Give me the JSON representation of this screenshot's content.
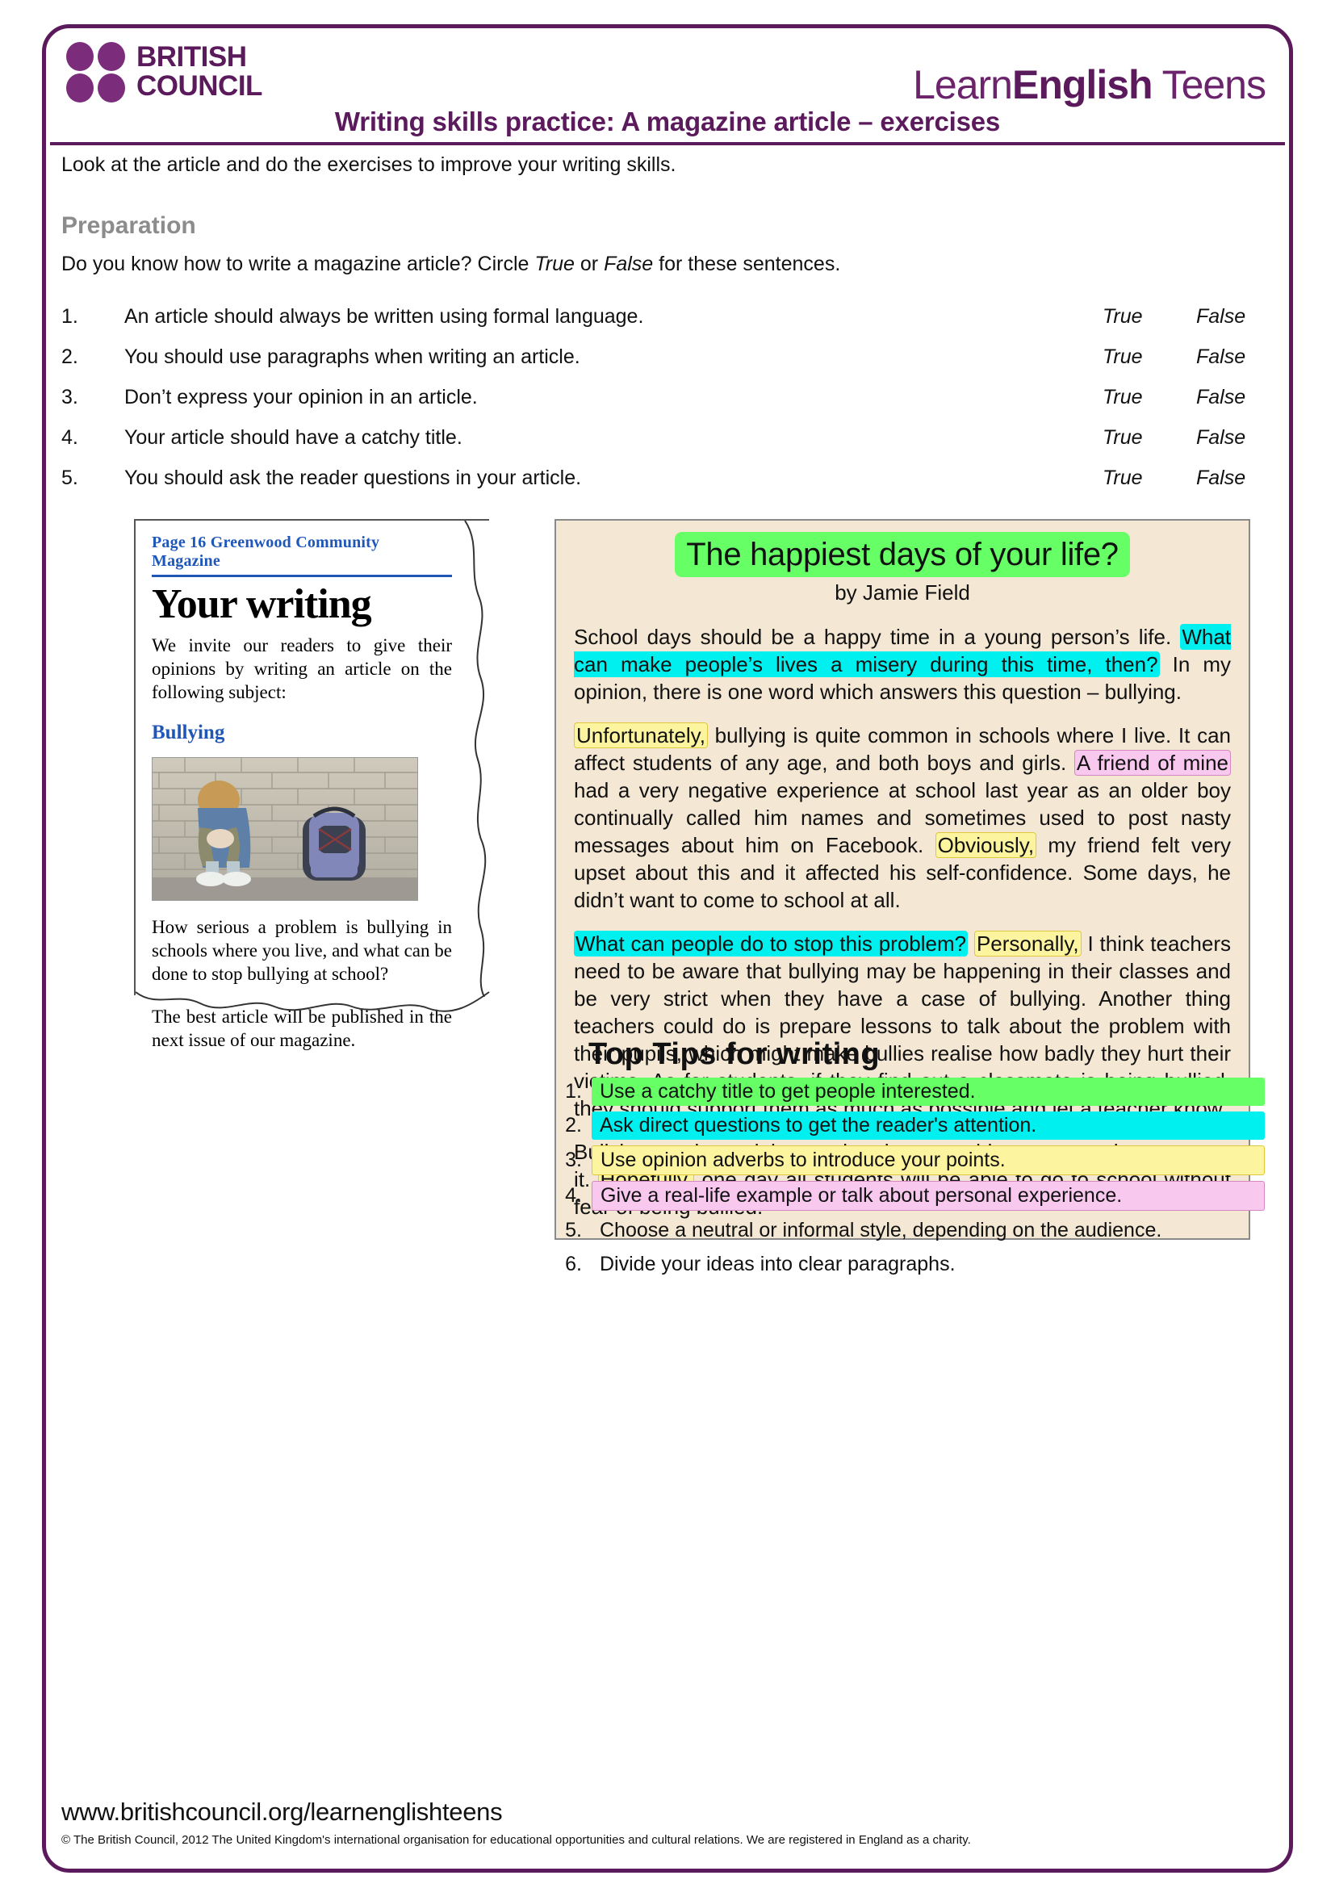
{
  "brand": {
    "council_line1": "BRITISH",
    "council_line2": "COUNCIL",
    "learn": "Learn",
    "english": "English",
    "teens": " Teens"
  },
  "header": {
    "document_title": "Writing skills practice: A magazine article – exercises"
  },
  "intro": "Look at the article and do the exercises to improve your writing skills.",
  "preparation": {
    "heading": "Preparation",
    "instruction_before": "Do you know how to write a magazine article? Circle ",
    "true_word": "True",
    "instruction_middle": " or ",
    "false_word": "False",
    "instruction_after": " for these sentences.",
    "questions": [
      {
        "num": "1.",
        "text": "An article should always be written using formal language.",
        "true": "True",
        "false": "False"
      },
      {
        "num": "2.",
        "text": "You should use paragraphs when writing an article.",
        "true": "True",
        "false": "False"
      },
      {
        "num": "3.",
        "text": "Don’t express your opinion in an article.",
        "true": "True",
        "false": "False"
      },
      {
        "num": "4.",
        "text": "Your article should have a catchy title.",
        "true": "True",
        "false": "False"
      },
      {
        "num": "5.",
        "text": "You should ask the reader questions in your article.",
        "true": "True",
        "false": "False"
      }
    ]
  },
  "clipping": {
    "masthead": "Page 16  Greenwood Community Magazine",
    "title": "Your writing",
    "paragraph1": "We invite our readers to give their opinions by writing an article on the following subject:",
    "subject": "Bullying",
    "photo_alt": "boy-sitting-against-brick-wall-with-backpack",
    "paragraph2": "How serious a problem is bullying in schools where you live, and what can be done to stop bullying at school?",
    "paragraph3": "The best article will be published in the next issue of our magazine."
  },
  "article": {
    "title": "The happiest days of your life?",
    "byline": "by Jamie Field",
    "p1_a": "School days should be a happy time in a young person’s life. ",
    "p1_hl": "What can make people’s lives a misery during this time, then?",
    "p1_b": " In my opinion, there is one word which answers this question – bullying.",
    "p2_hl1": "Unfortunately,",
    "p2_a": " bullying is quite common in schools where I live. It can affect students of any age, and both boys and girls. ",
    "p2_hl2": "A friend of mine",
    "p2_b": " had a very negative experience at school last year as an older boy continually called him names and sometimes used to post nasty messages about him on Facebook. ",
    "p2_hl3": "Obviously,",
    "p2_c": " my friend felt very upset about this and it affected his self-confidence. Some days, he didn’t want to come to school at all.",
    "p3_hl1": "What can people do to stop this problem?",
    "p3_hl2": "Personally,",
    "p3_a": " I think teachers need to be aware that bullying may be happening in their classes and be very strict when they have a case of bullying. Another thing teachers could do is prepare lessons to talk about the problem with their pupils, which might make bullies realise how badly they hurt their victims. As for students, if they find out a classmate is being bullied, they should support them as much as possible and let a teacher know.",
    "p4_a": "Bullying can be a nightmare but there are things we can do to prevent it. ",
    "p4_hl": "Hopefully,",
    "p4_b": " one day all students will be able to go to school without fear of being bullied."
  },
  "tips": {
    "heading": "Top Tips for writing",
    "items": [
      {
        "num": "1.",
        "text": "Use a catchy title to get people interested.",
        "style": "green"
      },
      {
        "num": "2.",
        "text": "Ask direct questions to get the reader's attention.",
        "style": "cyan"
      },
      {
        "num": "3.",
        "text": "Use opinion adverbs to introduce your points.",
        "style": "yellow"
      },
      {
        "num": "4.",
        "text": "Give a real-life example or talk about personal experience.",
        "style": "pink"
      },
      {
        "num": "5.",
        "text": "Choose a neutral or informal style, depending on the audience.",
        "style": "plain"
      },
      {
        "num": "6.",
        "text": "Divide your ideas into clear paragraphs.",
        "style": "plain"
      }
    ]
  },
  "footer": {
    "url": "www.britishcouncil.org/learnenglishteens",
    "copyright": "© The British Council, 2012 The United Kingdom's international organisation for educational opportunities and cultural relations. We are registered in England as a charity."
  },
  "colors": {
    "brand_purple": "#5B1A5B",
    "highlight_green": "#66FF66",
    "highlight_cyan": "#00F0F0",
    "highlight_yellow": "#FDF4A0",
    "highlight_pink": "#F9C8EE",
    "article_bg": "#F4E7D4",
    "masthead_blue": "#1F57B8"
  }
}
